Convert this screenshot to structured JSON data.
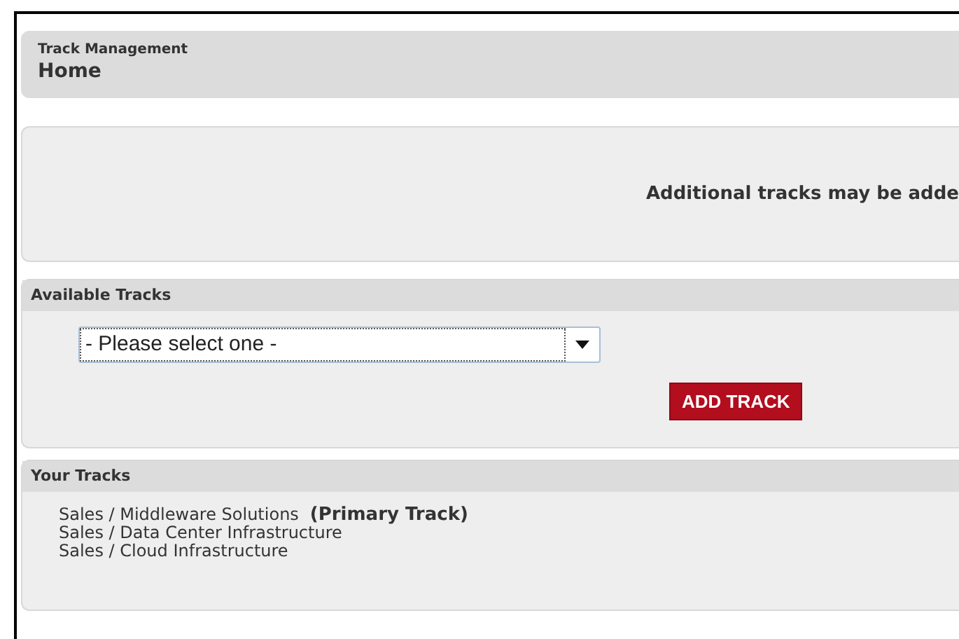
{
  "header": {
    "section": "Track Management",
    "title": "Home"
  },
  "notice": {
    "text": "Additional tracks may be adde"
  },
  "available_tracks": {
    "heading": "Available Tracks",
    "select": {
      "value": "- Please select one -"
    },
    "button": "ADD TRACK"
  },
  "your_tracks": {
    "heading": "Your Tracks",
    "items": [
      {
        "name": "Sales / Middleware Solutions",
        "tag": "(Primary Track)"
      },
      {
        "name": "Sales / Data Center Infrastructure"
      },
      {
        "name": "Sales / Cloud Infrastructure"
      }
    ]
  }
}
